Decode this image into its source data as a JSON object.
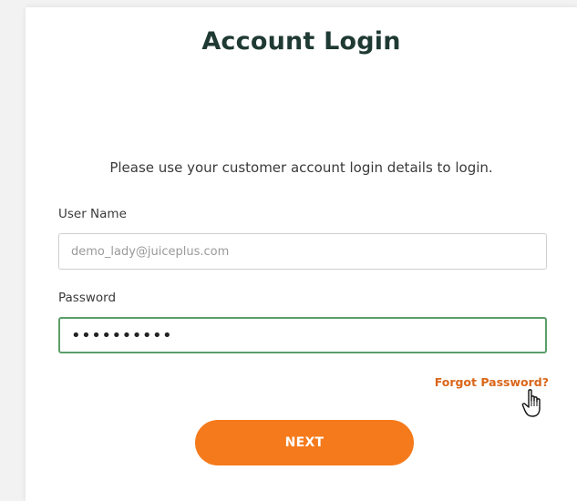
{
  "login": {
    "title": "Account Login",
    "instructions": "Please use your customer account login details to login.",
    "username": {
      "label": "User Name",
      "value": "demo_lady@juiceplus.com"
    },
    "password": {
      "label": "Password",
      "value": "••••••••••"
    },
    "forgot_link": "Forgot Password?",
    "next_button": "NEXT"
  },
  "colors": {
    "title": "#1f3a33",
    "accent": "#f57a1b",
    "link": "#d9661a",
    "focus_border": "#5a9e6a"
  },
  "icons": {
    "cursor": "hand-pointer-icon"
  }
}
